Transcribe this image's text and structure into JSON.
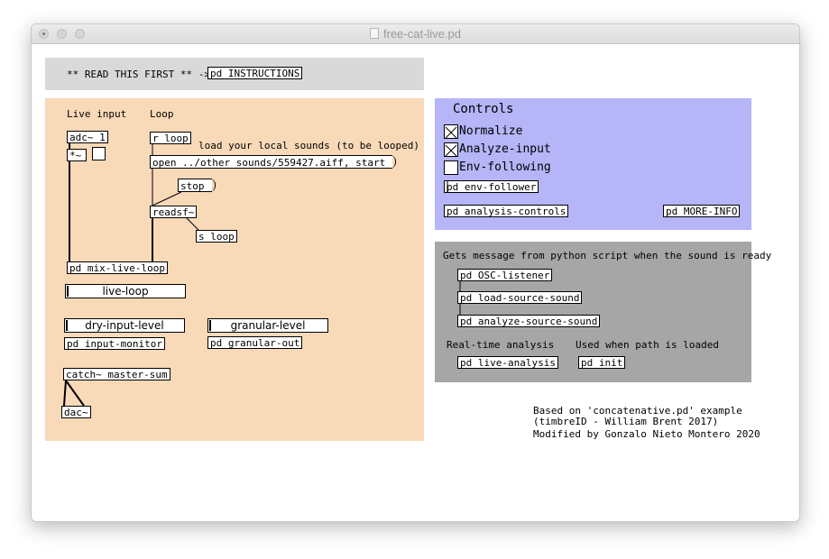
{
  "window": {
    "title": "free-cat-live.pd"
  },
  "header": {
    "read_first": "** READ THIS FIRST ** ->",
    "instructions": "pd INSTRUCTIONS"
  },
  "left": {
    "live_input_label": "Live input",
    "loop_label": "Loop",
    "adc": "adc~ 1",
    "mul": "*~",
    "r_loop": "r loop",
    "load_comment": "load your local sounds (to be looped)",
    "open_msg": "open ../other_sounds/559427.aiff, start",
    "stop_msg": "stop",
    "readsf": "readsf~",
    "s_loop": "s loop",
    "mix": "pd mix-live-loop",
    "live_loop_slider": "live-loop",
    "dry_slider": "dry-input-level",
    "granular_slider": "granular-level",
    "input_monitor": "pd input-monitor",
    "granular_out": "pd granular-out",
    "catch": "catch~ master-sum",
    "dac": "dac~"
  },
  "controls": {
    "title": "Controls",
    "normalize": "Normalize",
    "analyze_input": "Analyze-input",
    "env_following": "Env-following",
    "normalize_checked": true,
    "analyze_checked": true,
    "env_checked": false,
    "env_follower": "pd env-follower",
    "analysis_controls": "pd analysis-controls",
    "more_info": "pd MORE-INFO"
  },
  "python": {
    "comment": "Gets message from python script when the sound is ready",
    "osc": "pd OSC-listener",
    "load_source": "pd load-source-sound",
    "analyze_source": "pd analyze-source-sound",
    "realtime_label": "Real-time analysis",
    "path_label": "Used when path is loaded",
    "live_analysis": "pd live-analysis",
    "init": "pd init"
  },
  "credits": {
    "line1": "Based on 'concatenative.pd' example",
    "line2": "(timbreID - William Brent 2017)",
    "line3": "Modified by Gonzalo Nieto Montero 2020"
  },
  "colors": {
    "header_bg": "#d9d9d9",
    "left_bg": "#f8d9b8",
    "controls_bg": "#b5b5f8",
    "python_bg": "#a6a6a6"
  }
}
